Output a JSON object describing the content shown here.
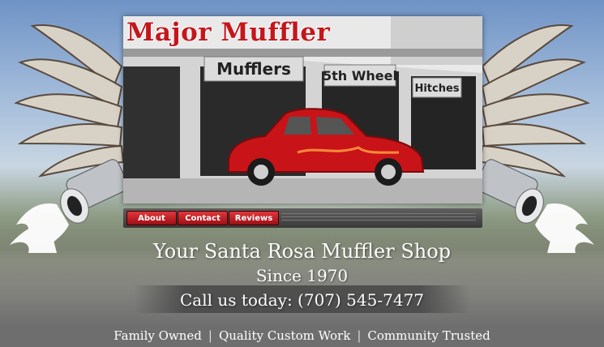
{
  "header": {
    "brand": "Major Muffler"
  },
  "photo": {
    "sign_1": "Mufflers",
    "sign_2": "5th Wheel",
    "sign_3": "Hitches"
  },
  "nav": {
    "items": [
      {
        "label": "About"
      },
      {
        "label": "Contact"
      },
      {
        "label": "Reviews"
      }
    ]
  },
  "hero": {
    "headline": "Your Santa Rosa Muffler Shop",
    "since": "Since 1970",
    "phone": "Call us today: (707) 545-7477"
  },
  "footer": {
    "items": [
      "Family Owned",
      "Quality Custom Work",
      "Community Trusted"
    ],
    "separator": "|"
  },
  "colors": {
    "accent": "#c4161c",
    "nav_bg": "#4a4a4a",
    "footer_bg": "#6e6e6e"
  }
}
